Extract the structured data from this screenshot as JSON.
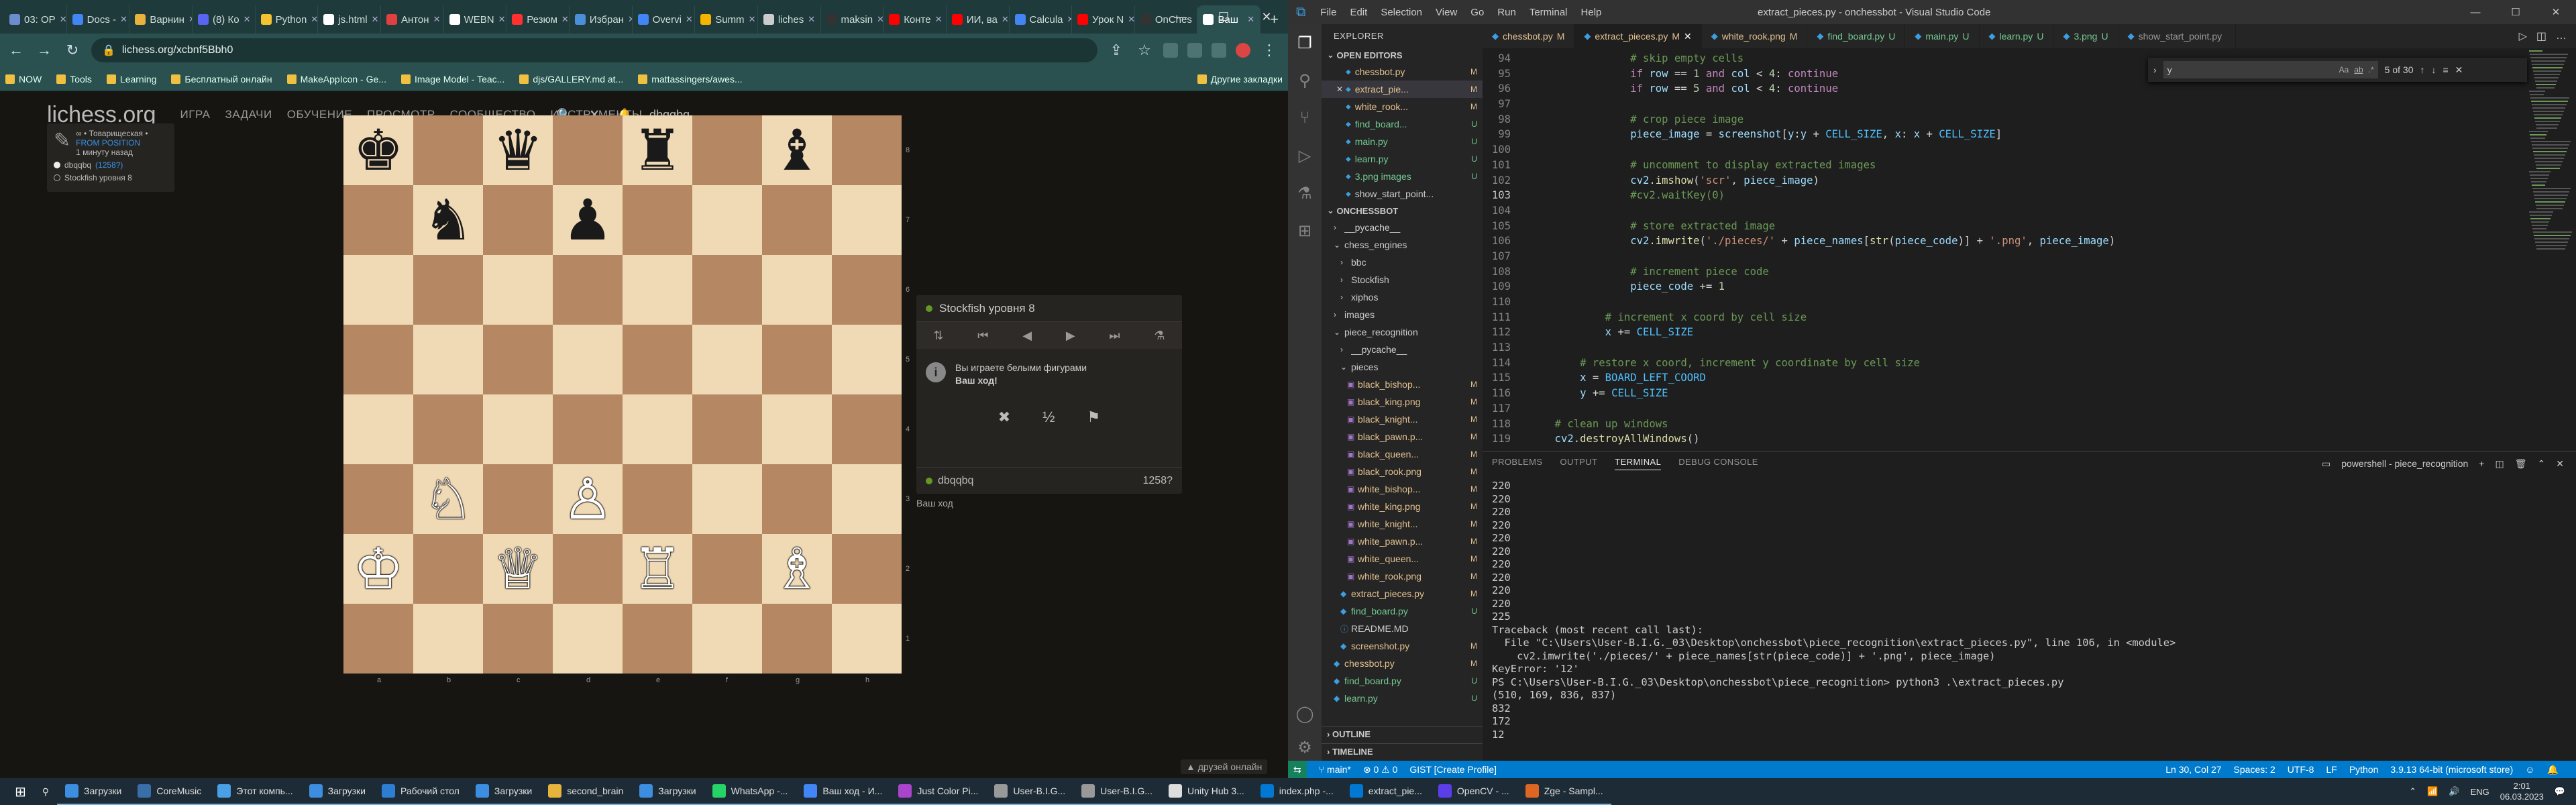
{
  "browser": {
    "tabs": [
      {
        "label": "03: OP",
        "color": "#6b8cce"
      },
      {
        "label": "Docs -",
        "color": "#4285f4"
      },
      {
        "label": "Варнин",
        "color": "#e8b33c"
      },
      {
        "label": "(8) Ко",
        "color": "#5865f2"
      },
      {
        "label": "Python",
        "color": "#f4c430"
      },
      {
        "label": "js.html",
        "color": "#ffffff"
      },
      {
        "label": "Антон",
        "color": "#e04040"
      },
      {
        "label": "WEBN",
        "color": "#ffffff"
      },
      {
        "label": "Резюм",
        "color": "#ff3030"
      },
      {
        "label": "Избран",
        "color": "#4a90d9"
      },
      {
        "label": "Overvi",
        "color": "#4285f4"
      },
      {
        "label": "Summ",
        "color": "#f4b400"
      },
      {
        "label": "liches",
        "color": "#cccccc"
      },
      {
        "label": "maksin",
        "color": "#333333"
      },
      {
        "label": "Конте",
        "color": "#ff0000"
      },
      {
        "label": "ИИ, ва",
        "color": "#ff0000"
      },
      {
        "label": "Calcula",
        "color": "#4285f4"
      },
      {
        "label": "Урок N",
        "color": "#ff0000"
      },
      {
        "label": "OnChes",
        "color": "#333333"
      },
      {
        "label": "Ваш",
        "color": "#ffffff",
        "active": true
      }
    ],
    "new_tab": "+",
    "url": "lichess.org/xcbnf5Bbh0",
    "bookmarks": [
      {
        "label": "NOW"
      },
      {
        "label": "Tools"
      },
      {
        "label": "Learning"
      },
      {
        "label": "Бесплатный онлайн"
      },
      {
        "label": "MakeAppIcon - Ge..."
      },
      {
        "label": "Image Model - Teac..."
      },
      {
        "label": "djs/GALLERY.md at..."
      },
      {
        "label": "mattassingers/awes..."
      }
    ],
    "bookmarks_right": "Другие закладки"
  },
  "lichess": {
    "logo": "lichess.org",
    "nav": [
      "ИГРА",
      "ЗАДАЧИ",
      "ОБУЧЕНИЕ",
      "ПРОСМОТР",
      "СООБЩЕСТВО",
      "ИНСТРУМЕНТЫ"
    ],
    "username": "dbqqbq",
    "game_line": "∞ • Товарищеская • ",
    "from_position": "FROM POSITION",
    "time_ago": "1 минуту назад",
    "white_player": "dbqqbq",
    "white_rating": "(1258?)",
    "black_player": "Stockfish уровня 8",
    "files": [
      "a",
      "b",
      "c",
      "d",
      "e",
      "f",
      "g",
      "h"
    ],
    "ranks": [
      "8",
      "7",
      "6",
      "5",
      "4",
      "3",
      "2",
      "1"
    ],
    "pieces": [
      {
        "square": "a8",
        "glyph": "♚",
        "color": "black"
      },
      {
        "square": "c8",
        "glyph": "♛",
        "color": "black"
      },
      {
        "square": "e8",
        "glyph": "♜",
        "color": "black"
      },
      {
        "square": "g8",
        "glyph": "♝",
        "color": "black"
      },
      {
        "square": "b7",
        "glyph": "♞",
        "color": "black"
      },
      {
        "square": "d7",
        "glyph": "♟",
        "color": "black"
      },
      {
        "square": "b3",
        "glyph": "♘",
        "color": "white"
      },
      {
        "square": "d3",
        "glyph": "♙",
        "color": "white"
      },
      {
        "square": "a2",
        "glyph": "♔",
        "color": "white"
      },
      {
        "square": "c2",
        "glyph": "♕",
        "color": "white"
      },
      {
        "square": "e2",
        "glyph": "♖",
        "color": "white"
      },
      {
        "square": "g2",
        "glyph": "♗",
        "color": "white"
      }
    ],
    "panel_opponent": "Stockfish уровня 8",
    "panel_message_1": "Вы играете белыми фигурами",
    "panel_message_2": "Ваш ход!",
    "panel_player": "dbqqbq",
    "panel_rating": "1258?",
    "your_turn": "Ваш ход",
    "friends": "▲ друзей онлайн",
    "half": "½"
  },
  "vscode": {
    "title": "extract_pieces.py - onchessbot - Visual Studio Code",
    "menu": [
      "File",
      "Edit",
      "Selection",
      "View",
      "Go",
      "Run",
      "Terminal",
      "Help"
    ],
    "explorer_title": "EXPLORER",
    "open_editors_title": "OPEN EDITORS",
    "open_editors": [
      {
        "name": "chessbot.py",
        "status": "M"
      },
      {
        "name": "extract_pie...",
        "status": "M",
        "selected": true
      },
      {
        "name": "white_rook...",
        "status": "M"
      },
      {
        "name": "find_board...",
        "status": "U"
      },
      {
        "name": "main.py",
        "status": "U"
      },
      {
        "name": "learn.py",
        "status": "U"
      },
      {
        "name": "3.png images",
        "status": "U"
      },
      {
        "name": "show_start_point...",
        "status": ""
      }
    ],
    "project_title": "ONCHESSBOT",
    "tree": [
      {
        "name": "__pycache__",
        "depth": 1,
        "status": "",
        "kind": "folder"
      },
      {
        "name": "chess_engines",
        "depth": 1,
        "status": "",
        "kind": "folder-open"
      },
      {
        "name": "bbc",
        "depth": 2,
        "status": "",
        "kind": "folder"
      },
      {
        "name": "Stockfish",
        "depth": 2,
        "status": "",
        "kind": "folder"
      },
      {
        "name": "xiphos",
        "depth": 2,
        "status": "",
        "kind": "folder"
      },
      {
        "name": "images",
        "depth": 1,
        "status": "",
        "kind": "folder"
      },
      {
        "name": "piece_recognition",
        "depth": 1,
        "status": "",
        "kind": "folder-open"
      },
      {
        "name": "__pycache__",
        "depth": 2,
        "status": "",
        "kind": "folder"
      },
      {
        "name": "pieces",
        "depth": 2,
        "status": "",
        "kind": "folder-open"
      },
      {
        "name": "black_bishop...",
        "depth": 3,
        "status": "M",
        "kind": "img"
      },
      {
        "name": "black_king.png",
        "depth": 3,
        "status": "M",
        "kind": "img"
      },
      {
        "name": "black_knight...",
        "depth": 3,
        "status": "M",
        "kind": "img"
      },
      {
        "name": "black_pawn.p...",
        "depth": 3,
        "status": "M",
        "kind": "img"
      },
      {
        "name": "black_queen...",
        "depth": 3,
        "status": "M",
        "kind": "img"
      },
      {
        "name": "black_rook.png",
        "depth": 3,
        "status": "M",
        "kind": "img"
      },
      {
        "name": "white_bishop...",
        "depth": 3,
        "status": "M",
        "kind": "img"
      },
      {
        "name": "white_king.png",
        "depth": 3,
        "status": "M",
        "kind": "img"
      },
      {
        "name": "white_knight...",
        "depth": 3,
        "status": "M",
        "kind": "img"
      },
      {
        "name": "white_pawn.p...",
        "depth": 3,
        "status": "M",
        "kind": "img"
      },
      {
        "name": "white_queen...",
        "depth": 3,
        "status": "M",
        "kind": "img"
      },
      {
        "name": "white_rook.png",
        "depth": 3,
        "status": "M",
        "kind": "img"
      },
      {
        "name": "extract_pieces.py",
        "depth": 2,
        "status": "M",
        "kind": "py"
      },
      {
        "name": "find_board.py",
        "depth": 2,
        "status": "U",
        "kind": "py"
      },
      {
        "name": "README.MD",
        "depth": 2,
        "status": "",
        "kind": "md"
      },
      {
        "name": "screenshot.py",
        "depth": 2,
        "status": "M",
        "kind": "py"
      },
      {
        "name": "chessbot.py",
        "depth": 1,
        "status": "M",
        "kind": "py"
      },
      {
        "name": "find_board.py",
        "depth": 1,
        "status": "U",
        "kind": "py"
      },
      {
        "name": "learn.py",
        "depth": 1,
        "status": "U",
        "kind": "py"
      }
    ],
    "outline": "OUTLINE",
    "timeline": "TIMELINE",
    "editor_tabs": [
      {
        "name": "chessbot.py",
        "status": "M"
      },
      {
        "name": "extract_pieces.py",
        "status": "M",
        "active": true
      },
      {
        "name": "white_rook.png",
        "status": "M"
      },
      {
        "name": "find_board.py",
        "status": "U"
      },
      {
        "name": "main.py",
        "status": "U"
      },
      {
        "name": "learn.py",
        "status": "U"
      },
      {
        "name": "3.png",
        "status": "U"
      },
      {
        "name": "show_start_point.py",
        "status": ""
      }
    ],
    "find": {
      "value": "y",
      "count": "5 of 30",
      "match_case": "Aa",
      "whole_word": "ab",
      "regex": ".*"
    },
    "code_lines": [
      {
        "n": "94",
        "segs": [
          [
            "cmt",
            "                # skip empty cells"
          ]
        ]
      },
      {
        "n": "95",
        "segs": [
          [
            "kw",
            "                if "
          ],
          [
            "var",
            "row"
          ],
          [
            "pl",
            " == "
          ],
          [
            "num",
            "1"
          ],
          [
            "kw",
            " and "
          ],
          [
            "var",
            "col"
          ],
          [
            "pl",
            " < "
          ],
          [
            "num",
            "4"
          ],
          [
            "pl",
            ": "
          ],
          [
            "kw",
            "continue"
          ]
        ]
      },
      {
        "n": "96",
        "segs": [
          [
            "kw",
            "                if "
          ],
          [
            "var",
            "row"
          ],
          [
            "pl",
            " == "
          ],
          [
            "num",
            "5"
          ],
          [
            "kw",
            " and "
          ],
          [
            "var",
            "col"
          ],
          [
            "pl",
            " < "
          ],
          [
            "num",
            "4"
          ],
          [
            "pl",
            ": "
          ],
          [
            "kw",
            "continue"
          ]
        ]
      },
      {
        "n": "97",
        "segs": [
          [
            "pl",
            ""
          ]
        ]
      },
      {
        "n": "98",
        "segs": [
          [
            "cmt",
            "                # crop piece image"
          ]
        ]
      },
      {
        "n": "99",
        "segs": [
          [
            "var",
            "                piece_image"
          ],
          [
            "pl",
            " = "
          ],
          [
            "var",
            "screenshot"
          ],
          [
            "pl",
            "["
          ],
          [
            "var",
            "y"
          ],
          [
            "pl",
            ":"
          ],
          [
            "var",
            "y"
          ],
          [
            "pl",
            " + "
          ],
          [
            "cst",
            "CELL_SIZE"
          ],
          [
            "pl",
            ", "
          ],
          [
            "var",
            "x"
          ],
          [
            "pl",
            ": "
          ],
          [
            "var",
            "x"
          ],
          [
            "pl",
            " + "
          ],
          [
            "cst",
            "CELL_SIZE"
          ],
          [
            "pl",
            "]"
          ]
        ]
      },
      {
        "n": "100",
        "segs": [
          [
            "pl",
            ""
          ]
        ]
      },
      {
        "n": "101",
        "segs": [
          [
            "cmt",
            "                # uncomment to display extracted images"
          ]
        ]
      },
      {
        "n": "102",
        "segs": [
          [
            "var",
            "                cv2"
          ],
          [
            "pl",
            "."
          ],
          [
            "fn",
            "imshow"
          ],
          [
            "pl",
            "("
          ],
          [
            "str",
            "'scr'"
          ],
          [
            "pl",
            ", "
          ],
          [
            "var",
            "piece_image"
          ],
          [
            "pl",
            ")"
          ]
        ]
      },
      {
        "n": "103",
        "segs": [
          [
            "cmt",
            "                #cv2.waitKey(0)"
          ]
        ]
      },
      {
        "n": "104",
        "segs": [
          [
            "pl",
            ""
          ]
        ]
      },
      {
        "n": "105",
        "segs": [
          [
            "cmt",
            "                # store extracted image"
          ]
        ]
      },
      {
        "n": "106",
        "segs": [
          [
            "var",
            "                cv2"
          ],
          [
            "pl",
            "."
          ],
          [
            "fn",
            "imwrite"
          ],
          [
            "pl",
            "("
          ],
          [
            "str",
            "'./pieces/'"
          ],
          [
            "pl",
            " + "
          ],
          [
            "var",
            "piece_names"
          ],
          [
            "pl",
            "["
          ],
          [
            "fn",
            "str"
          ],
          [
            "pl",
            "("
          ],
          [
            "var",
            "piece_code"
          ],
          [
            "pl",
            ")] + "
          ],
          [
            "str",
            "'.png'"
          ],
          [
            "pl",
            ", "
          ],
          [
            "var",
            "piece_image"
          ],
          [
            "pl",
            ")"
          ]
        ]
      },
      {
        "n": "107",
        "segs": [
          [
            "pl",
            ""
          ]
        ]
      },
      {
        "n": "108",
        "segs": [
          [
            "cmt",
            "                # increment piece code"
          ]
        ]
      },
      {
        "n": "109",
        "segs": [
          [
            "var",
            "                piece_code"
          ],
          [
            "pl",
            " += "
          ],
          [
            "num",
            "1"
          ]
        ]
      },
      {
        "n": "110",
        "segs": [
          [
            "pl",
            ""
          ]
        ]
      },
      {
        "n": "111",
        "segs": [
          [
            "cmt",
            "            # increment x coord by cell size"
          ]
        ]
      },
      {
        "n": "112",
        "segs": [
          [
            "var",
            "            x"
          ],
          [
            "pl",
            " += "
          ],
          [
            "cst",
            "CELL_SIZE"
          ]
        ]
      },
      {
        "n": "113",
        "segs": [
          [
            "pl",
            ""
          ]
        ]
      },
      {
        "n": "114",
        "segs": [
          [
            "cmt",
            "        # restore x coord, increment y coordinate by cell size"
          ]
        ]
      },
      {
        "n": "115",
        "segs": [
          [
            "var",
            "        x"
          ],
          [
            "pl",
            " = "
          ],
          [
            "cst",
            "BOARD_LEFT_COORD"
          ]
        ]
      },
      {
        "n": "116",
        "segs": [
          [
            "var",
            "        y"
          ],
          [
            "pl",
            " += "
          ],
          [
            "cst",
            "CELL_SIZE"
          ]
        ]
      },
      {
        "n": "117",
        "segs": [
          [
            "pl",
            ""
          ]
        ]
      },
      {
        "n": "118",
        "segs": [
          [
            "cmt",
            "    # clean up windows"
          ]
        ]
      },
      {
        "n": "119",
        "segs": [
          [
            "var",
            "    cv2"
          ],
          [
            "pl",
            "."
          ],
          [
            "fn",
            "destroyAllWindows"
          ],
          [
            "pl",
            "()"
          ]
        ]
      }
    ],
    "current_line": "103",
    "panel_tabs": [
      "PROBLEMS",
      "OUTPUT",
      "TERMINAL",
      "DEBUG CONSOLE"
    ],
    "active_panel_tab": "TERMINAL",
    "terminal_name": "powershell - piece_recognition",
    "terminal_lines": [
      "220",
      "220",
      "220",
      "220",
      "220",
      "220",
      "220",
      "220",
      "220",
      "220",
      "225",
      "Traceback (most recent call last):",
      "  File \"C:\\Users\\User-B.I.G._03\\Desktop\\onchessbot\\piece_recognition\\extract_pieces.py\", line 106, in <module>",
      "    cv2.imwrite('./pieces/' + piece_names[str(piece_code)] + '.png', piece_image)",
      "KeyError: '12'",
      "PS C:\\Users\\User-B.I.G._03\\Desktop\\onchessbot\\piece_recognition> python3 .\\extract_pieces.py",
      "(510, 169, 836, 837)",
      "832",
      "172",
      "12"
    ],
    "status": {
      "branch": "main*",
      "errors": "⊗ 0 ⚠ 0",
      "gist": "GIST [Create Profile]",
      "position": "Ln 30, Col 27",
      "spaces": "Spaces: 2",
      "encoding": "UTF-8",
      "eol": "LF",
      "language": "Python",
      "interpreter": "3.9.13 64-bit (microsoft store)"
    }
  },
  "taskbar": {
    "items": [
      {
        "label": "Загрузки",
        "color": "#3d8ee0"
      },
      {
        "label": "CoreMusic",
        "color": "#3a6ea8"
      },
      {
        "label": "Этот компь...",
        "color": "#4aa0e6"
      },
      {
        "label": "Загрузки",
        "color": "#3d8ee0"
      },
      {
        "label": "Рабочий стол",
        "color": "#2d7dd2"
      },
      {
        "label": "Загрузки",
        "color": "#3d8ee0"
      },
      {
        "label": "second_brain",
        "color": "#e8b33c"
      },
      {
        "label": "Загрузки",
        "color": "#3d8ee0"
      },
      {
        "label": "WhatsApp -...",
        "color": "#25d366"
      },
      {
        "label": "Ваш ход - И...",
        "color": "#4285f4"
      },
      {
        "label": "Just Color Pi...",
        "color": "#aa44cc"
      },
      {
        "label": "User-B.I.G...",
        "color": "#999999"
      },
      {
        "label": "User-B.I.G...",
        "color": "#999999"
      },
      {
        "label": "Unity Hub 3...",
        "color": "#dddddd"
      },
      {
        "label": "index.php -...",
        "color": "#0078d4"
      },
      {
        "label": "extract_pie...",
        "color": "#0078d4"
      },
      {
        "label": "OpenCV - ...",
        "color": "#5c3ee8"
      },
      {
        "label": "Zge - Sampl...",
        "color": "#dd6622"
      }
    ],
    "lang": "ENG",
    "time": "2:01",
    "date": "06.03.2023"
  }
}
